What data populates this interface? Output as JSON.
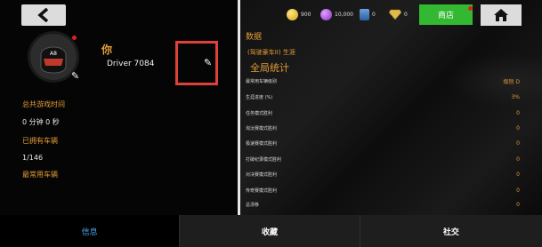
{
  "header": {
    "currencies": [
      {
        "name": "gold-coin",
        "value": "900",
        "color": "#e6c43a"
      },
      {
        "name": "purple-token",
        "value": "10,000",
        "color": "#b34fe0"
      },
      {
        "name": "blue-card",
        "value": "0",
        "color": "#4a7fc0"
      },
      {
        "name": "diamond",
        "value": "0",
        "color": "#d8b04a"
      }
    ],
    "shop_label": "商店"
  },
  "profile": {
    "you_label": "你",
    "driver_name": "Driver 7084",
    "avatar_badge": "A8"
  },
  "left_stats": {
    "total_time_label": "总共游戏时间",
    "total_time_value": "0 分钟 0 秒",
    "owned_cars_label": "已拥有车辆",
    "owned_cars_value": "1/146",
    "most_used_label": "最常用车辆"
  },
  "right_stats": {
    "section_title": "数据",
    "source_link": "(驾驶豪车II) 生涯",
    "global_title": "全局统计",
    "rows": [
      {
        "label": "最常用车辆级别",
        "value": "级别 D"
      },
      {
        "label": "生涯进度 (%)",
        "value": "3%"
      },
      {
        "label": "任务模式胜利",
        "value": "0"
      },
      {
        "label": "淘汰赛模式胜利",
        "value": "0"
      },
      {
        "label": "极速赛模式胜利",
        "value": "0"
      },
      {
        "label": "打破纪录模式胜利",
        "value": "0"
      },
      {
        "label": "对决赛模式胜利",
        "value": "0"
      },
      {
        "label": "传奇赛模式胜利",
        "value": "0"
      },
      {
        "label": "总漂移",
        "value": "0"
      }
    ]
  },
  "tabs": [
    {
      "label": "信息"
    },
    {
      "label": "收藏"
    },
    {
      "label": "社交"
    }
  ]
}
